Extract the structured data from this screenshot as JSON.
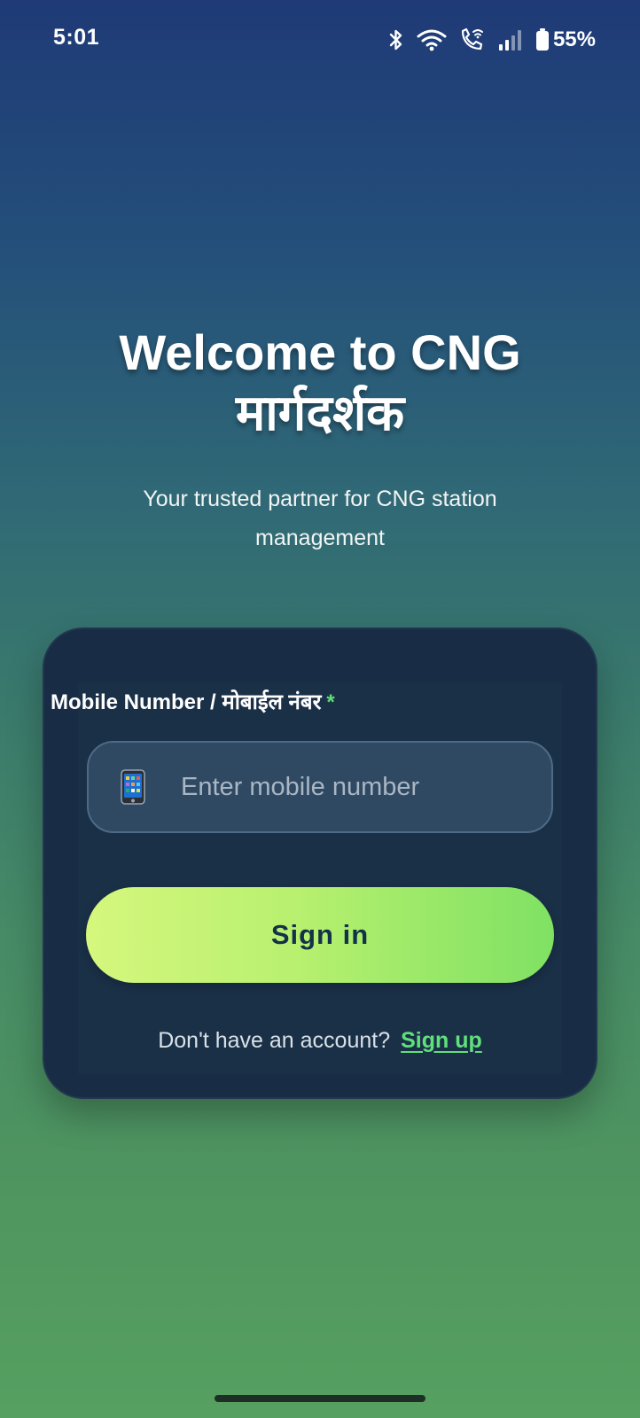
{
  "status_bar": {
    "time": "5:01",
    "battery_percent": "55%",
    "icons": [
      "bluetooth-icon",
      "wifi-icon",
      "wifi-calling-icon",
      "signal-icon",
      "battery-icon"
    ]
  },
  "welcome": {
    "title_line1": "Welcome to CNG",
    "title_line2": "मार्गदर्शक",
    "subtitle": "Your trusted partner for CNG station management"
  },
  "login_form": {
    "mobile_label": "Mobile Number / मोबाईल नंबर",
    "required_mark": "*",
    "mobile_placeholder": "Enter mobile number",
    "mobile_value": "",
    "phone_icon": "mobile-phone-icon",
    "sign_in_label": "Sign in",
    "no_account_text": "Don't have an account?",
    "sign_up_label": "Sign up"
  },
  "colors": {
    "accent_green": "#5fe07a",
    "button_gradient_start": "#d5f77d",
    "button_gradient_end": "#7fe163",
    "card_bg": "#192c46",
    "button_text": "#13324a"
  }
}
